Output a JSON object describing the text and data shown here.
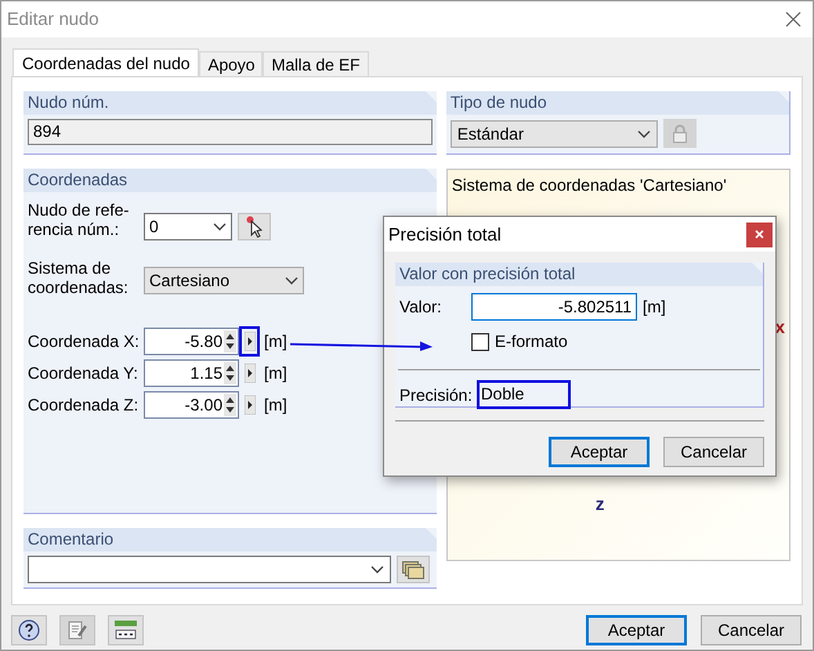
{
  "window": {
    "title": "Editar nudo"
  },
  "tabs": [
    {
      "label": "Coordenadas del nudo",
      "selected": true
    },
    {
      "label": "Apoyo",
      "selected": false
    },
    {
      "label": "Malla de EF",
      "selected": false
    }
  ],
  "node_number": {
    "title": "Nudo núm.",
    "value": "894"
  },
  "node_type": {
    "title": "Tipo de nudo",
    "value": "Estándar"
  },
  "coordinates": {
    "title": "Coordenadas",
    "reference_label": [
      "Nudo de refe-",
      "rencia núm.:"
    ],
    "reference_value": "0",
    "system_label": [
      "Sistema de",
      "coordenadas:"
    ],
    "system_value": "Cartesiano",
    "rows": [
      {
        "label": "Coordenada X:",
        "value": "-5.80",
        "unit": "[m]",
        "highlighted": true
      },
      {
        "label": "Coordenada Y:",
        "value": "1.15",
        "unit": "[m]",
        "highlighted": false
      },
      {
        "label": "Coordenada Z:",
        "value": "-3.00",
        "unit": "[m]",
        "highlighted": false
      }
    ]
  },
  "preview": {
    "caption": "Sistema de coordenadas 'Cartesiano'",
    "axis_x": "x",
    "axis_z": "z"
  },
  "comment": {
    "title": "Comentario"
  },
  "buttons": [
    {
      "label": "Aceptar",
      "default": true
    },
    {
      "label": "Cancelar",
      "default": false
    }
  ],
  "dialog": {
    "title": "Precisión total",
    "group_title": "Valor con precisión total",
    "value_label": "Valor:",
    "value": "-5.802511",
    "unit": "[m]",
    "checkbox": {
      "label": "E-formato",
      "checked": false
    },
    "precision_label": "Precisión:",
    "precision_value": "Doble",
    "precision_highlighted": true,
    "buttons": [
      {
        "label": "Aceptar",
        "default": true
      },
      {
        "label": "Cancelar",
        "default": false
      }
    ]
  }
}
